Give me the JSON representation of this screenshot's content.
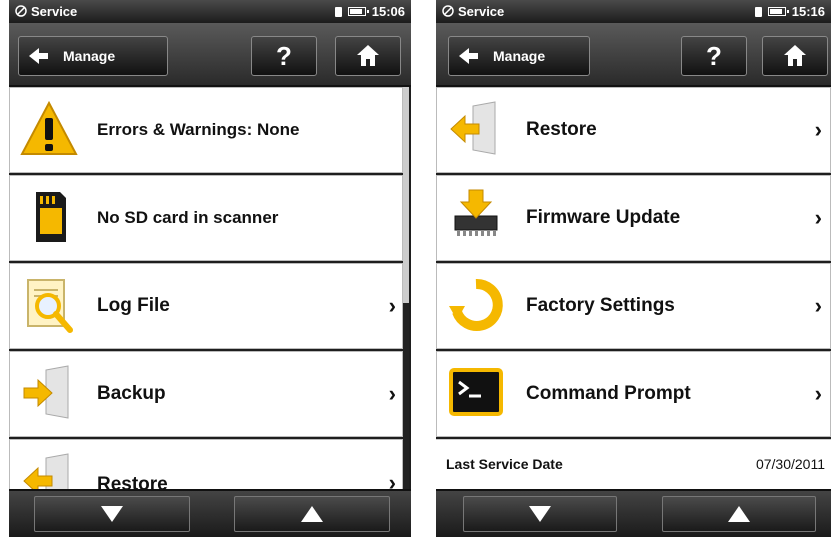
{
  "left": {
    "status": {
      "app": "Service",
      "time": "15:06"
    },
    "toolbar": {
      "back_label": "Manage",
      "help_label": "?"
    },
    "items": [
      {
        "label": "Errors & Warnings: None"
      },
      {
        "label": "No SD card in scanner"
      },
      {
        "label": "Log File",
        "chevron": "›"
      },
      {
        "label": "Backup",
        "chevron": "›"
      },
      {
        "label": "Restore",
        "chevron": "›"
      }
    ]
  },
  "right": {
    "status": {
      "app": "Service",
      "time": "15:16"
    },
    "toolbar": {
      "back_label": "Manage",
      "help_label": "?"
    },
    "items": [
      {
        "label": "Restore",
        "chevron": "›"
      },
      {
        "label": "Firmware Update",
        "chevron": "›"
      },
      {
        "label": "Factory Settings",
        "chevron": "›"
      },
      {
        "label": "Command Prompt",
        "chevron": "›"
      }
    ],
    "info": {
      "key": "Last Service Date",
      "value": "07/30/2011"
    }
  },
  "colors": {
    "accent_yellow": "#f5b800",
    "bar_dark": "#2a2a2a"
  },
  "icons": {
    "warning": "warning-icon",
    "sd": "sd-card-icon",
    "log": "log-file-icon",
    "backup": "backup-icon",
    "restore": "restore-icon",
    "firmware": "firmware-icon",
    "factory": "factory-reset-icon",
    "prompt": "command-prompt-icon"
  }
}
